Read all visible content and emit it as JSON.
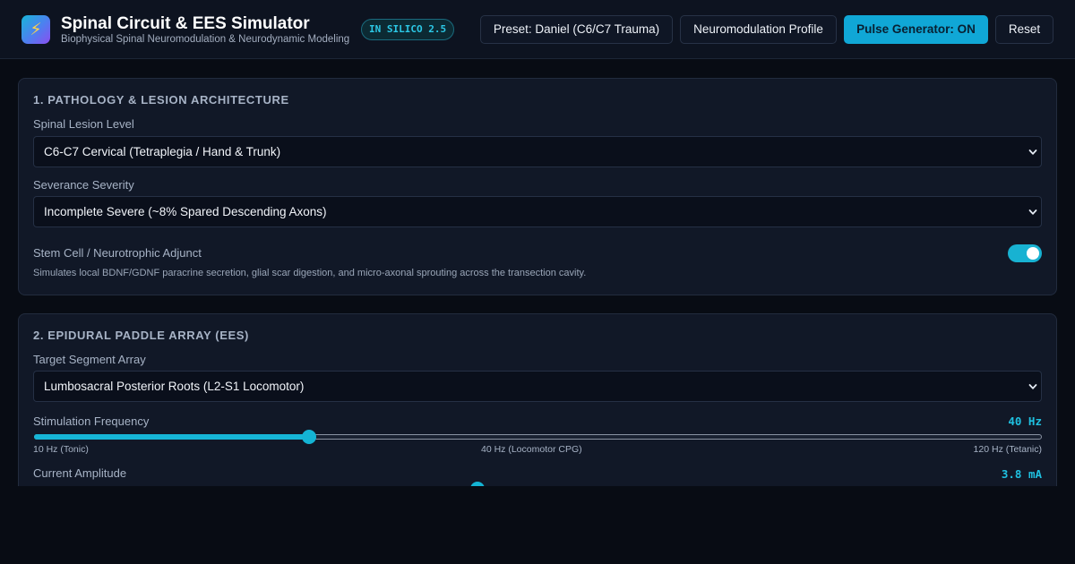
{
  "header": {
    "logo_icon": "lightning-bolt-icon",
    "logo_glyph": "⚡",
    "title": "Spinal Circuit & EES Simulator",
    "subtitle": "Biophysical Spinal Neuromodulation & Neurodynamic Modeling",
    "version_badge": "IN SILICO 2.5",
    "buttons": {
      "preset": "Preset: Daniel (C6/C7 Trauma)",
      "profile": "Neuromodulation Profile",
      "pulse": "Pulse Generator: ON",
      "reset": "Reset"
    }
  },
  "pathology": {
    "title": "1. PATHOLOGY & LESION ARCHITECTURE",
    "lesion_level": {
      "label": "Spinal Lesion Level",
      "value": "C6-C7 Cervical (Tetraplegia / Hand & Trunk)"
    },
    "severity": {
      "label": "Severance Severity",
      "value": "Incomplete Severe (~8% Spared Descending Axons)"
    },
    "stem_cell": {
      "label": "Stem Cell / Neurotrophic Adjunct",
      "enabled": true,
      "description": "Simulates local BDNF/GDNF paracrine secretion, glial scar digestion, and micro-axonal sprouting across the transection cavity."
    }
  },
  "ees": {
    "title": "2. EPIDURAL PADDLE ARRAY (EES)",
    "target": {
      "label": "Target Segment Array",
      "value": "Lumbosacral Posterior Roots (L2-S1 Locomotor)"
    },
    "frequency": {
      "label": "Stimulation Frequency",
      "readout": "40 Hz",
      "value": 40,
      "min": 10,
      "max": 120,
      "tick_min": "10 Hz (Tonic)",
      "tick_mid": "40 Hz (Locomotor CPG)",
      "tick_max": "120 Hz (Tetanic)"
    },
    "amplitude": {
      "label": "Current Amplitude",
      "readout": "3.8 mA",
      "fraction": 0.44
    }
  },
  "colors": {
    "accent": "#16b5d6",
    "background": "#080c14",
    "card": "#111827"
  }
}
